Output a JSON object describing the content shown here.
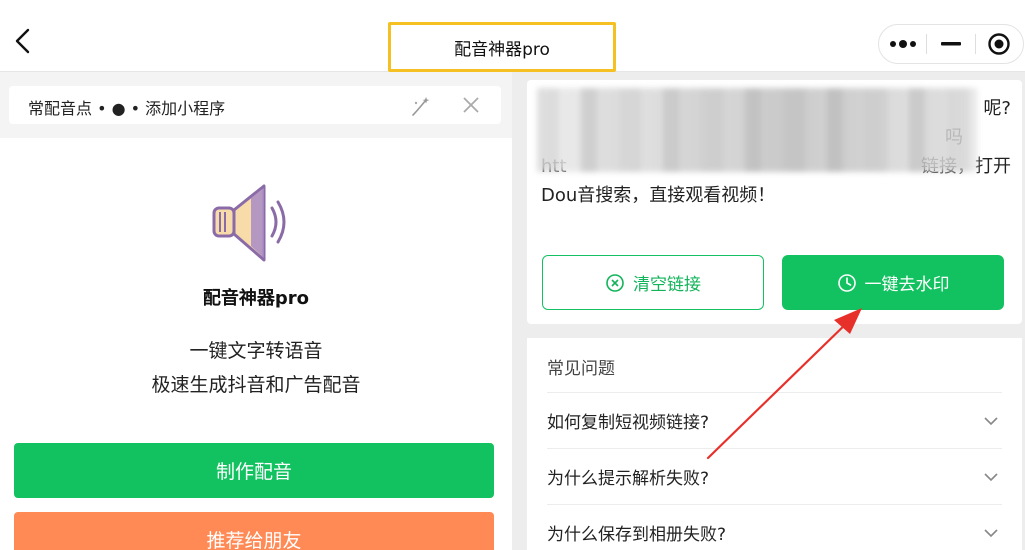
{
  "header": {
    "title": "配音神器pro",
    "back_icon": "chevron-left-icon",
    "capsule": {
      "more_icon": "more-dots-icon",
      "minimize_icon": "minimize-icon",
      "close_icon": "target-close-icon"
    }
  },
  "add_bar": {
    "text": "常配音点 • ● • 添加小程序",
    "wand_icon": "magic-wand-icon",
    "close_icon": "close-icon"
  },
  "app": {
    "icon": "speaker-icon",
    "name": "配音神器pro",
    "desc_line1": "一键文字转语音",
    "desc_line2": "极速生成抖音和广告配音",
    "make_button": "制作配音",
    "share_button": "推荐给朋友"
  },
  "link_card": {
    "line1_tail": "呢?",
    "line2_tail": "吗",
    "line3_prefix": "htt",
    "line3_tail": "链接，打开",
    "line4": "Dou音搜索，直接观看视频！",
    "clear_button": "清空链接",
    "clear_icon": "circle-x-icon",
    "remove_button": "一键去水印",
    "remove_icon": "clock-icon"
  },
  "faq": {
    "title": "常见问题",
    "items": [
      {
        "q": "如何复制短视频链接?"
      },
      {
        "q": "为什么提示解析失败?"
      },
      {
        "q": "为什么保存到相册失败?"
      }
    ],
    "chevron_icon": "chevron-down-icon"
  },
  "colors": {
    "primary_green": "#12c15f",
    "share_orange": "#ff8a55",
    "title_highlight": "#f5c022",
    "annotation_arrow": "#e8302a"
  }
}
